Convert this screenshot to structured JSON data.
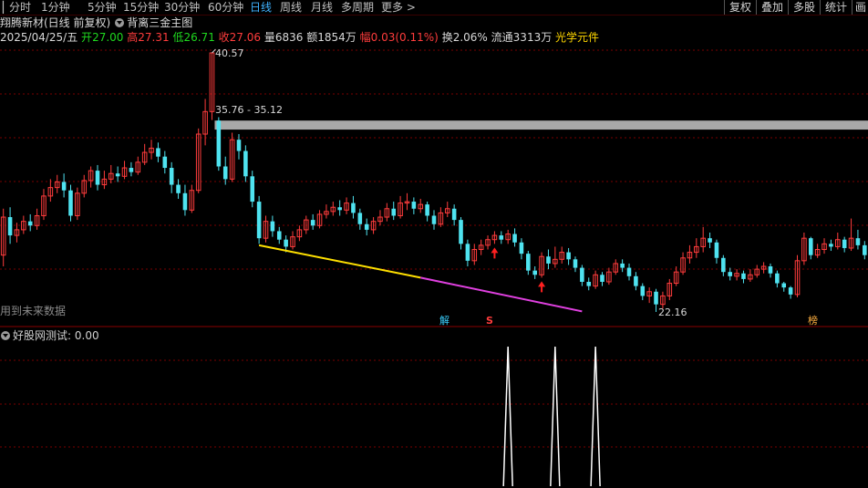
{
  "periods": [
    "分时",
    "1分钟",
    "5分钟",
    "15分钟",
    "30分钟",
    "60分钟",
    "日线",
    "周线",
    "月线",
    "多周期",
    "更多 >"
  ],
  "active_period": "日线",
  "right_buttons": [
    "复权",
    "叠加",
    "多股",
    "统计",
    "画"
  ],
  "stock": {
    "title": "翔腾新材(日线 前复权)",
    "indicator": "背离三金主图"
  },
  "quote": {
    "date": "2025/04/25/五",
    "open_label": "开",
    "open": "27.00",
    "high_label": "高",
    "high": "27.31",
    "low_label": "低",
    "low": "26.71",
    "close_label": "收",
    "close": "27.06",
    "vol_label": "量",
    "vol": "6836",
    "amt_label": "额",
    "amt": "1854万",
    "chg_label": "幅",
    "chg": "0.03(0.11%)",
    "turn_label": "换",
    "turn": "2.06%",
    "float_label": "流通",
    "float": "3313万",
    "concept": "光学元件"
  },
  "annotations": {
    "high_price": "40.57",
    "gap_zone": "35.76 - 35.12",
    "low_price": "22.16",
    "future_warning": "用到未来数据",
    "tag_jie": "解",
    "tag_s": "S",
    "tag_bang": "榜"
  },
  "sub": {
    "title": "好股网测试",
    "value": ": 0.00"
  },
  "colors": {
    "up": "#ff3c3c",
    "down": "#4fe3f0",
    "zone": "#a8a8a8",
    "yellow_line": "#ffe000",
    "magenta_line": "#e040e0",
    "grid": "#7a0000"
  },
  "chart_data": {
    "type": "candlestick",
    "price_axis": {
      "min": 22.16,
      "max": 40.57
    },
    "candles": [
      [
        26.2,
        28.9,
        25.4,
        29.5
      ],
      [
        28.9,
        27.6,
        27.0,
        29.6
      ],
      [
        27.6,
        28.0,
        27.1,
        28.5
      ],
      [
        28.0,
        28.6,
        27.7,
        29.0
      ],
      [
        28.6,
        28.3,
        27.9,
        29.1
      ],
      [
        28.3,
        29.0,
        28.0,
        29.5
      ],
      [
        29.0,
        30.4,
        28.7,
        30.9
      ],
      [
        30.4,
        31.0,
        30.0,
        31.6
      ],
      [
        31.0,
        31.4,
        30.6,
        31.9
      ],
      [
        31.4,
        30.8,
        30.3,
        32.0
      ],
      [
        30.8,
        29.0,
        28.6,
        31.2
      ],
      [
        29.0,
        30.6,
        28.7,
        31.0
      ],
      [
        30.6,
        31.5,
        30.3,
        31.9
      ],
      [
        31.5,
        32.2,
        31.0,
        32.5
      ],
      [
        32.2,
        31.2,
        30.8,
        32.6
      ],
      [
        31.2,
        31.6,
        30.9,
        32.2
      ],
      [
        31.6,
        32.0,
        31.3,
        32.6
      ],
      [
        32.0,
        31.8,
        31.4,
        32.5
      ],
      [
        31.8,
        32.4,
        31.6,
        32.9
      ],
      [
        32.4,
        32.1,
        31.8,
        32.8
      ],
      [
        32.1,
        32.8,
        31.9,
        33.2
      ],
      [
        32.8,
        33.5,
        32.6,
        34.1
      ],
      [
        33.5,
        33.8,
        33.0,
        34.4
      ],
      [
        33.8,
        33.2,
        32.8,
        34.2
      ],
      [
        33.2,
        32.4,
        32.0,
        33.6
      ],
      [
        32.4,
        31.2,
        30.6,
        32.8
      ],
      [
        31.2,
        30.6,
        30.2,
        31.6
      ],
      [
        30.6,
        29.4,
        29.0,
        31.2
      ],
      [
        29.4,
        30.8,
        29.2,
        31.2
      ],
      [
        30.8,
        34.8,
        30.6,
        35.2
      ],
      [
        34.8,
        36.4,
        34.0,
        37.3
      ],
      [
        36.4,
        40.57,
        35.8,
        40.57
      ],
      [
        35.76,
        32.5,
        32.2,
        36.0
      ],
      [
        32.5,
        31.6,
        31.2,
        33.2
      ],
      [
        31.6,
        34.4,
        31.4,
        34.9
      ],
      [
        34.4,
        33.6,
        33.0,
        34.8
      ],
      [
        33.6,
        31.8,
        31.4,
        34.0
      ],
      [
        31.8,
        30.0,
        29.6,
        32.2
      ],
      [
        30.0,
        27.4,
        27.0,
        30.4
      ],
      [
        27.4,
        28.6,
        27.1,
        29.0
      ],
      [
        28.6,
        27.9,
        27.5,
        29.0
      ],
      [
        27.9,
        27.3,
        27.0,
        28.2
      ],
      [
        27.3,
        26.8,
        26.4,
        27.6
      ],
      [
        26.8,
        27.5,
        26.6,
        27.9
      ],
      [
        27.5,
        28.0,
        27.2,
        28.3
      ],
      [
        28.0,
        28.7,
        27.7,
        29.0
      ],
      [
        28.7,
        28.3,
        28.0,
        29.1
      ],
      [
        28.3,
        29.1,
        28.1,
        29.4
      ],
      [
        29.1,
        29.3,
        28.8,
        29.8
      ],
      [
        29.3,
        29.6,
        29.0,
        30.0
      ],
      [
        29.6,
        29.4,
        29.0,
        30.1
      ],
      [
        29.4,
        29.9,
        29.1,
        30.3
      ],
      [
        29.9,
        29.2,
        28.8,
        30.4
      ],
      [
        29.2,
        28.4,
        28.0,
        29.5
      ],
      [
        28.4,
        28.0,
        27.6,
        28.8
      ],
      [
        28.0,
        28.6,
        27.7,
        28.9
      ],
      [
        28.6,
        28.9,
        28.3,
        29.4
      ],
      [
        28.9,
        29.5,
        28.6,
        29.9
      ],
      [
        29.5,
        29.0,
        28.7,
        30.0
      ],
      [
        29.0,
        29.9,
        28.8,
        30.4
      ],
      [
        29.9,
        30.0,
        29.4,
        30.6
      ],
      [
        30.0,
        29.5,
        29.1,
        30.3
      ],
      [
        29.5,
        29.8,
        29.2,
        30.2
      ],
      [
        29.8,
        29.0,
        28.6,
        30.0
      ],
      [
        29.0,
        28.4,
        28.0,
        29.4
      ],
      [
        28.4,
        29.2,
        28.2,
        29.6
      ],
      [
        29.2,
        29.5,
        28.9,
        30.0
      ],
      [
        29.5,
        28.7,
        28.3,
        29.8
      ],
      [
        28.7,
        27.0,
        26.6,
        28.9
      ],
      [
        27.0,
        25.8,
        25.4,
        27.3
      ],
      [
        25.8,
        26.6,
        25.5,
        27.0
      ],
      [
        26.6,
        26.9,
        26.2,
        27.3
      ],
      [
        26.9,
        27.3,
        26.6,
        27.6
      ],
      [
        27.3,
        27.6,
        27.0,
        27.9
      ],
      [
        27.6,
        27.3,
        27.0,
        27.9
      ],
      [
        27.3,
        27.7,
        27.0,
        28.0
      ],
      [
        27.7,
        27.1,
        26.8,
        28.1
      ],
      [
        27.1,
        26.3,
        25.9,
        27.4
      ],
      [
        26.3,
        25.1,
        24.8,
        26.5
      ],
      [
        25.1,
        24.8,
        24.5,
        25.4
      ],
      [
        24.8,
        26.1,
        24.6,
        26.4
      ],
      [
        26.1,
        25.6,
        25.2,
        26.6
      ],
      [
        25.6,
        25.9,
        25.3,
        26.8
      ],
      [
        25.9,
        26.4,
        25.6,
        26.8
      ],
      [
        26.4,
        25.9,
        25.5,
        26.7
      ],
      [
        25.9,
        25.3,
        25.0,
        26.1
      ],
      [
        25.3,
        24.3,
        24.0,
        25.5
      ],
      [
        24.3,
        24.0,
        23.7,
        24.6
      ],
      [
        24.0,
        24.8,
        23.8,
        25.1
      ],
      [
        24.8,
        24.3,
        24.0,
        25.0
      ],
      [
        24.3,
        25.0,
        24.1,
        25.3
      ],
      [
        25.0,
        25.6,
        24.8,
        25.9
      ],
      [
        25.6,
        25.3,
        25.0,
        25.9
      ],
      [
        25.3,
        24.7,
        24.4,
        25.6
      ],
      [
        24.7,
        24.0,
        23.7,
        25.0
      ],
      [
        24.0,
        23.3,
        23.0,
        24.2
      ],
      [
        23.3,
        23.6,
        22.8,
        23.9
      ],
      [
        23.6,
        22.7,
        22.16,
        23.8
      ],
      [
        22.7,
        23.3,
        22.4,
        23.6
      ],
      [
        23.3,
        24.2,
        23.0,
        24.5
      ],
      [
        24.2,
        25.0,
        24.0,
        25.4
      ],
      [
        25.0,
        26.0,
        24.8,
        26.4
      ],
      [
        26.0,
        26.4,
        25.6,
        26.9
      ],
      [
        26.4,
        26.8,
        26.0,
        27.4
      ],
      [
        26.8,
        27.4,
        26.4,
        28.2
      ],
      [
        27.4,
        27.1,
        26.7,
        27.8
      ],
      [
        27.1,
        26.0,
        25.6,
        27.3
      ],
      [
        26.0,
        25.0,
        24.7,
        26.2
      ],
      [
        25.0,
        24.7,
        24.4,
        25.3
      ],
      [
        24.7,
        24.9,
        24.4,
        25.2
      ],
      [
        24.9,
        24.5,
        24.2,
        25.1
      ],
      [
        24.5,
        24.8,
        24.3,
        25.2
      ],
      [
        24.8,
        25.2,
        24.6,
        25.5
      ],
      [
        25.2,
        25.4,
        24.9,
        25.7
      ],
      [
        25.4,
        24.9,
        24.6,
        25.6
      ],
      [
        24.9,
        24.2,
        23.9,
        25.1
      ],
      [
        24.2,
        23.9,
        23.6,
        24.3
      ],
      [
        23.9,
        23.4,
        23.1,
        24.0
      ],
      [
        23.4,
        25.8,
        23.2,
        26.2
      ],
      [
        25.8,
        27.4,
        25.5,
        27.8
      ],
      [
        27.4,
        26.2,
        25.9,
        27.5
      ],
      [
        26.2,
        26.6,
        26.0,
        27.0
      ],
      [
        26.6,
        27.0,
        26.3,
        27.4
      ],
      [
        27.0,
        26.8,
        26.5,
        27.3
      ],
      [
        26.8,
        27.3,
        26.6,
        27.8
      ],
      [
        27.3,
        26.7,
        26.4,
        27.5
      ],
      [
        26.7,
        27.4,
        26.5,
        28.8
      ],
      [
        27.4,
        26.9,
        26.6,
        28.0
      ],
      [
        26.9,
        26.2,
        25.9,
        27.2
      ]
    ],
    "zone_band": {
      "from": 35.76,
      "to": 35.12
    },
    "yellow_line": {
      "from_price": 26.9,
      "to_price": 24.6
    },
    "magenta_line": {
      "from_price": 24.6,
      "to_price": 22.2
    },
    "sub_signal": {
      "values": [
        0,
        0,
        0
      ],
      "peaks": [
        1,
        1,
        1
      ]
    }
  }
}
